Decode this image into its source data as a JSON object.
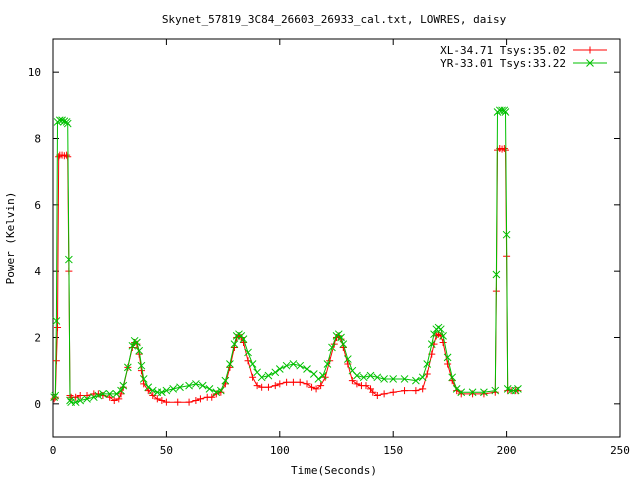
{
  "chart_data": {
    "type": "line",
    "title": "Skynet_57819_3C84_26603_26933_cal.txt, LOWRES, daisy",
    "xlabel": "Time(Seconds)",
    "ylabel": "Power (Kelvin)",
    "xlim": [
      0,
      250
    ],
    "ylim": [
      -1,
      11
    ],
    "xticks": [
      0,
      50,
      100,
      150,
      200,
      250
    ],
    "yticks": [
      0,
      2,
      4,
      6,
      8,
      10
    ],
    "grid": false,
    "legend_position": "top-right",
    "series": [
      {
        "name": "XL-34.71 Tsys:35.02",
        "color": "#ff0000",
        "marker": "plus",
        "points": [
          [
            0.5,
            0.15
          ],
          [
            1,
            0.2
          ],
          [
            1.5,
            1.3
          ],
          [
            2,
            2.3
          ],
          [
            2.5,
            7.45
          ],
          [
            3,
            7.5
          ],
          [
            4,
            7.5
          ],
          [
            5,
            7.48
          ],
          [
            6,
            7.5
          ],
          [
            6.5,
            7.45
          ],
          [
            7,
            4.0
          ],
          [
            7.5,
            0.25
          ],
          [
            8,
            0.2
          ],
          [
            10,
            0.2
          ],
          [
            12,
            0.25
          ],
          [
            15,
            0.25
          ],
          [
            18,
            0.3
          ],
          [
            20,
            0.3
          ],
          [
            22,
            0.25
          ],
          [
            25,
            0.2
          ],
          [
            27,
            0.1
          ],
          [
            29,
            0.15
          ],
          [
            30,
            0.3
          ],
          [
            31,
            0.5
          ],
          [
            33,
            1.1
          ],
          [
            35,
            1.7
          ],
          [
            36,
            1.85
          ],
          [
            37,
            1.8
          ],
          [
            38,
            1.5
          ],
          [
            39,
            1.0
          ],
          [
            40,
            0.6
          ],
          [
            42,
            0.4
          ],
          [
            44,
            0.25
          ],
          [
            46,
            0.15
          ],
          [
            48,
            0.1
          ],
          [
            50,
            0.05
          ],
          [
            55,
            0.05
          ],
          [
            60,
            0.05
          ],
          [
            63,
            0.1
          ],
          [
            65,
            0.15
          ],
          [
            68,
            0.2
          ],
          [
            70,
            0.2
          ],
          [
            72,
            0.3
          ],
          [
            74,
            0.35
          ],
          [
            76,
            0.6
          ],
          [
            78,
            1.1
          ],
          [
            80,
            1.7
          ],
          [
            81,
            2.0
          ],
          [
            82,
            2.05
          ],
          [
            83,
            2.0
          ],
          [
            84,
            1.85
          ],
          [
            86,
            1.3
          ],
          [
            88,
            0.8
          ],
          [
            90,
            0.55
          ],
          [
            92,
            0.5
          ],
          [
            95,
            0.5
          ],
          [
            98,
            0.55
          ],
          [
            100,
            0.6
          ],
          [
            103,
            0.65
          ],
          [
            106,
            0.65
          ],
          [
            109,
            0.65
          ],
          [
            112,
            0.6
          ],
          [
            114,
            0.5
          ],
          [
            116,
            0.45
          ],
          [
            118,
            0.55
          ],
          [
            120,
            0.8
          ],
          [
            122,
            1.3
          ],
          [
            124,
            1.8
          ],
          [
            125,
            2.0
          ],
          [
            126,
            2.05
          ],
          [
            127,
            1.95
          ],
          [
            128,
            1.7
          ],
          [
            130,
            1.2
          ],
          [
            132,
            0.7
          ],
          [
            134,
            0.6
          ],
          [
            136,
            0.55
          ],
          [
            138,
            0.55
          ],
          [
            140,
            0.45
          ],
          [
            141,
            0.35
          ],
          [
            143,
            0.25
          ],
          [
            146,
            0.3
          ],
          [
            150,
            0.35
          ],
          [
            155,
            0.4
          ],
          [
            160,
            0.4
          ],
          [
            163,
            0.45
          ],
          [
            165,
            0.9
          ],
          [
            167,
            1.5
          ],
          [
            168,
            1.8
          ],
          [
            169,
            2.05
          ],
          [
            170,
            2.1
          ],
          [
            171,
            2.05
          ],
          [
            172,
            1.85
          ],
          [
            174,
            1.2
          ],
          [
            176,
            0.7
          ],
          [
            178,
            0.4
          ],
          [
            180,
            0.3
          ],
          [
            185,
            0.3
          ],
          [
            190,
            0.3
          ],
          [
            195,
            0.35
          ],
          [
            195.5,
            3.4
          ],
          [
            196,
            7.65
          ],
          [
            197,
            7.7
          ],
          [
            198,
            7.68
          ],
          [
            199,
            7.7
          ],
          [
            199.5,
            7.65
          ],
          [
            200,
            4.45
          ],
          [
            200.5,
            0.4
          ],
          [
            202,
            0.4
          ],
          [
            204,
            0.4
          ],
          [
            205,
            0.4
          ]
        ]
      },
      {
        "name": "YR-33.01 Tsys:33.22",
        "color": "#00c000",
        "marker": "cross",
        "points": [
          [
            0.5,
            0.2
          ],
          [
            1,
            0.25
          ],
          [
            1.5,
            2.5
          ],
          [
            2,
            8.5
          ],
          [
            3,
            8.55
          ],
          [
            4,
            8.55
          ],
          [
            5,
            8.52
          ],
          [
            6,
            8.5
          ],
          [
            6.5,
            8.45
          ],
          [
            7,
            4.35
          ],
          [
            7.5,
            0.1
          ],
          [
            8,
            0.05
          ],
          [
            10,
            0.05
          ],
          [
            12,
            0.1
          ],
          [
            15,
            0.15
          ],
          [
            18,
            0.2
          ],
          [
            20,
            0.25
          ],
          [
            22,
            0.3
          ],
          [
            25,
            0.3
          ],
          [
            28,
            0.3
          ],
          [
            30,
            0.4
          ],
          [
            31,
            0.55
          ],
          [
            33,
            1.1
          ],
          [
            35,
            1.75
          ],
          [
            36,
            1.9
          ],
          [
            37,
            1.85
          ],
          [
            38,
            1.6
          ],
          [
            39,
            1.15
          ],
          [
            40,
            0.75
          ],
          [
            42,
            0.5
          ],
          [
            44,
            0.4
          ],
          [
            46,
            0.35
          ],
          [
            48,
            0.35
          ],
          [
            50,
            0.4
          ],
          [
            53,
            0.45
          ],
          [
            56,
            0.5
          ],
          [
            60,
            0.55
          ],
          [
            63,
            0.6
          ],
          [
            66,
            0.55
          ],
          [
            69,
            0.45
          ],
          [
            72,
            0.35
          ],
          [
            74,
            0.4
          ],
          [
            76,
            0.7
          ],
          [
            78,
            1.2
          ],
          [
            80,
            1.8
          ],
          [
            81,
            2.05
          ],
          [
            82,
            2.1
          ],
          [
            83,
            2.05
          ],
          [
            84,
            1.95
          ],
          [
            86,
            1.55
          ],
          [
            88,
            1.2
          ],
          [
            90,
            0.95
          ],
          [
            92,
            0.8
          ],
          [
            95,
            0.85
          ],
          [
            98,
            0.95
          ],
          [
            100,
            1.05
          ],
          [
            103,
            1.15
          ],
          [
            106,
            1.2
          ],
          [
            109,
            1.15
          ],
          [
            112,
            1.05
          ],
          [
            115,
            0.9
          ],
          [
            117,
            0.75
          ],
          [
            119,
            0.85
          ],
          [
            121,
            1.2
          ],
          [
            123,
            1.7
          ],
          [
            125,
            2.05
          ],
          [
            126,
            2.1
          ],
          [
            127,
            2.0
          ],
          [
            128,
            1.8
          ],
          [
            130,
            1.35
          ],
          [
            132,
            1.0
          ],
          [
            134,
            0.85
          ],
          [
            137,
            0.8
          ],
          [
            140,
            0.85
          ],
          [
            143,
            0.8
          ],
          [
            146,
            0.75
          ],
          [
            150,
            0.75
          ],
          [
            155,
            0.75
          ],
          [
            160,
            0.7
          ],
          [
            163,
            0.8
          ],
          [
            165,
            1.2
          ],
          [
            167,
            1.8
          ],
          [
            168,
            2.1
          ],
          [
            169,
            2.25
          ],
          [
            170,
            2.3
          ],
          [
            171,
            2.25
          ],
          [
            172,
            2.05
          ],
          [
            174,
            1.4
          ],
          [
            176,
            0.8
          ],
          [
            178,
            0.45
          ],
          [
            180,
            0.35
          ],
          [
            185,
            0.35
          ],
          [
            190,
            0.35
          ],
          [
            195,
            0.4
          ],
          [
            195.5,
            3.9
          ],
          [
            196,
            8.8
          ],
          [
            197,
            8.85
          ],
          [
            198,
            8.85
          ],
          [
            199,
            8.85
          ],
          [
            199.5,
            8.8
          ],
          [
            200,
            5.1
          ],
          [
            200.5,
            0.45
          ],
          [
            202,
            0.4
          ],
          [
            204,
            0.4
          ],
          [
            205,
            0.45
          ]
        ]
      }
    ]
  }
}
